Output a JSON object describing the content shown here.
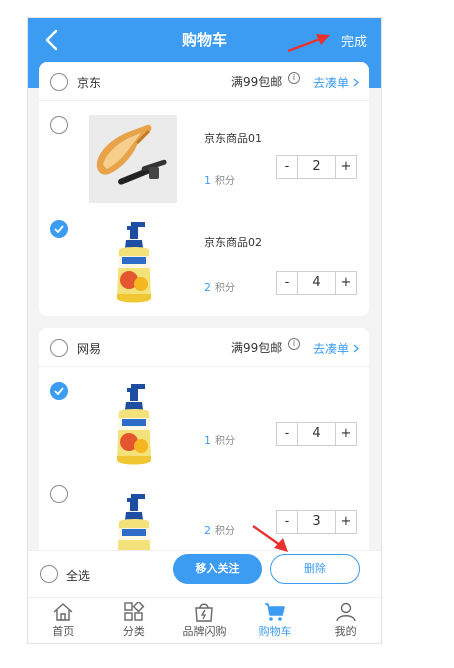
{
  "header": {
    "title": "购物车",
    "done_label": "完成"
  },
  "stores": [
    {
      "name": "京东",
      "promo": "满99包邮",
      "gather_label": "去凑单",
      "items": [
        {
          "name": "京东商品01",
          "points": "1",
          "points_unit": "积分",
          "qty": "2",
          "checked": false,
          "image": "car-vacuum"
        },
        {
          "name": "京东商品02",
          "points": "2",
          "points_unit": "积分",
          "qty": "4",
          "checked": true,
          "image": "soap-bottle"
        }
      ]
    },
    {
      "name": "网易",
      "promo": "满99包邮",
      "gather_label": "去凑单",
      "items": [
        {
          "name": "",
          "points": "1",
          "points_unit": "积分",
          "qty": "4",
          "checked": true,
          "image": "soap-bottle"
        },
        {
          "name": "",
          "points": "2",
          "points_unit": "积分",
          "qty": "3",
          "checked": false,
          "image": "soap-bottle"
        }
      ]
    }
  ],
  "stepper": {
    "minus": "-",
    "plus": "+"
  },
  "bottom_bar": {
    "select_all_label": "全选",
    "follow_label": "移入关注",
    "delete_label": "删除"
  },
  "tabs": [
    {
      "label": "首页",
      "icon": "home-icon",
      "active": false
    },
    {
      "label": "分类",
      "icon": "category-icon",
      "active": false
    },
    {
      "label": "品牌闪购",
      "icon": "flash-bag-icon",
      "active": false
    },
    {
      "label": "购物车",
      "icon": "cart-icon",
      "active": true
    },
    {
      "label": "我的",
      "icon": "profile-icon",
      "active": false
    }
  ],
  "colors": {
    "accent": "#3b9cf2",
    "annotation_arrow": "#e8322f"
  }
}
